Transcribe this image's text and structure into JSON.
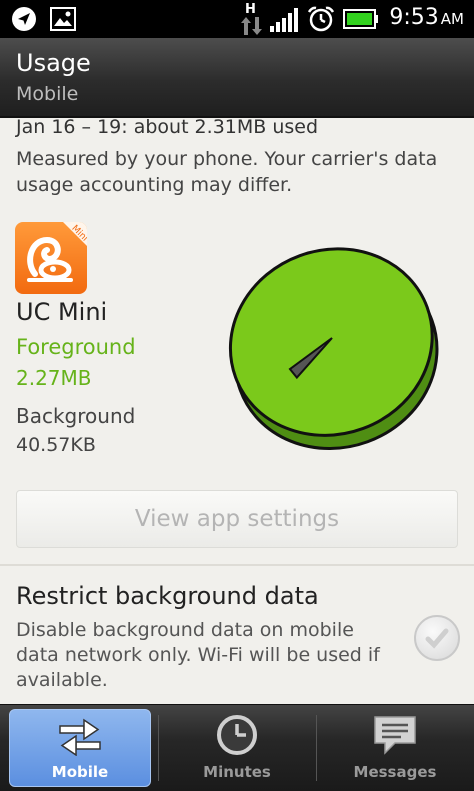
{
  "status_bar": {
    "time": "9:53",
    "ampm": "AM",
    "network_letter": "H",
    "icons": [
      "navigation-icon",
      "image-notification-icon",
      "data-transfer-icon",
      "signal-icon",
      "alarm-icon",
      "battery-icon"
    ]
  },
  "header": {
    "title": "Usage",
    "subtitle": "Mobile"
  },
  "usage": {
    "date_range": "Jan 16 – 19: about 2.31MB used",
    "note": "Measured by your phone. Your carrier's data usage accounting may differ."
  },
  "app": {
    "name": "UC Mini",
    "icon": "uc-mini-app-icon",
    "icon_badge": "Mini",
    "foreground_label": "Foreground",
    "foreground_value": "2.27MB",
    "background_label": "Background",
    "background_value": "40.57KB"
  },
  "chart_data": {
    "type": "pie",
    "slices": [
      {
        "label": "Foreground",
        "value": 2.27,
        "unit": "MB",
        "color": "#7bc91b"
      },
      {
        "label": "Background",
        "value": 0.04057,
        "unit": "MB",
        "color": "#555555"
      }
    ]
  },
  "actions": {
    "view_app_settings": "View app settings"
  },
  "restrict": {
    "title": "Restrict background data",
    "description": "Disable background data on mobile data network only. Wi-Fi will be used if available.",
    "checked": false
  },
  "bottom_nav": {
    "items": [
      {
        "label": "Mobile",
        "icon": "transfer-arrows-icon",
        "active": true
      },
      {
        "label": "Minutes",
        "icon": "clock-icon",
        "active": false
      },
      {
        "label": "Messages",
        "icon": "message-icon",
        "active": false
      }
    ]
  },
  "colors": {
    "accent_green": "#66b31a",
    "pie_green": "#7bc91b",
    "active_tab_blue": "#6d9de6"
  }
}
